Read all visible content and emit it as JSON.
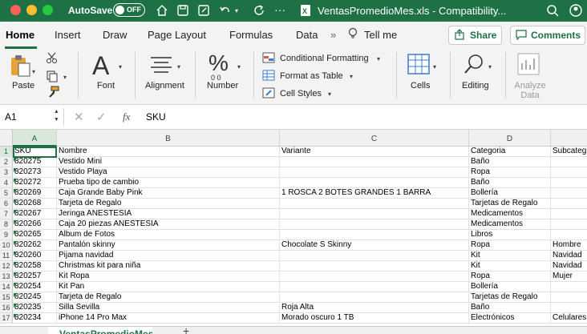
{
  "colors": {
    "brand": "#1e7145",
    "close": "#fe5f57",
    "minimize": "#febc2e",
    "maximize": "#28c840"
  },
  "titlebar": {
    "autosave_label": "AutoSave",
    "autosave_state": "OFF",
    "document_title": "VentasPromedioMes.xls - Compatibility...",
    "icons": [
      "home-icon",
      "save-icon",
      "edit-icon",
      "undo-icon",
      "redo-icon",
      "document-icon",
      "search-icon",
      "profile-icon"
    ]
  },
  "ribbon_tabs": {
    "items": [
      "Home",
      "Insert",
      "Draw",
      "Page Layout",
      "Formulas",
      "Data"
    ],
    "more": "»",
    "tell_me": "Tell me",
    "share": "Share",
    "comments": "Comments"
  },
  "ribbon": {
    "paste": "Paste",
    "font": "Font",
    "alignment": "Alignment",
    "number": "Number",
    "conditional_formatting": "Conditional Formatting",
    "format_as_table": "Format as Table",
    "cell_styles": "Cell Styles",
    "cells": "Cells",
    "editing": "Editing",
    "analyze_data": "Analyze Data"
  },
  "formula_bar": {
    "name_box": "A1",
    "fx": "fx",
    "content": "SKU"
  },
  "sheet": {
    "columns": [
      "A",
      "B",
      "C",
      "D",
      ""
    ],
    "rows": [
      [
        "SKU",
        "Nombre",
        "Variante",
        "Categoria",
        "Subcateg"
      ],
      [
        "820275",
        "Vestido Mini",
        "",
        "Baño",
        ""
      ],
      [
        "820273",
        "Vestido Playa",
        "",
        "Ropa",
        ""
      ],
      [
        "820272",
        "Prueba tipo de cambio",
        "",
        "Baño",
        ""
      ],
      [
        "820269",
        "Caja Grande Baby Pink",
        "1 ROSCA   2 BOTES GRANDES   1 BARRA",
        "Bollería",
        ""
      ],
      [
        "820268",
        "Tarjeta de Regalo",
        "",
        "Tarjetas de Regalo",
        ""
      ],
      [
        "820267",
        "Jeringa ANESTESIA",
        "",
        "Medicamentos",
        ""
      ],
      [
        "820266",
        "Caja 20 piezas ANESTESIA",
        "",
        "Medicamentos",
        ""
      ],
      [
        "820265",
        "Album de Fotos",
        "",
        "Libros",
        ""
      ],
      [
        "820262",
        "Pantalón skinny",
        "Chocolate S Skinny",
        "Ropa",
        "Hombre"
      ],
      [
        "820260",
        "Pijama navidad",
        "",
        "Kit",
        "Navidad"
      ],
      [
        "820258",
        "Christmas kit para niña",
        "",
        "Kit",
        "Navidad"
      ],
      [
        "820257",
        "Kit Ropa",
        "",
        "Ropa",
        "Mujer"
      ],
      [
        "820254",
        "Kit Pan",
        "",
        "Bollería",
        ""
      ],
      [
        "820245",
        "Tarjeta de Regalo",
        "",
        "Tarjetas de Regalo",
        ""
      ],
      [
        "820235",
        "Silla Sevilla",
        "Roja Alta",
        "Baño",
        ""
      ],
      [
        "820234",
        "iPhone 14 Pro Max",
        "Morado oscuro 1 TB",
        "Electrónicos",
        "Celulares"
      ]
    ],
    "row_numbers": [
      "1",
      "2",
      "3",
      "4",
      "5",
      "6",
      "7",
      "8",
      "9",
      "10",
      "11",
      "12",
      "13",
      "14",
      "15",
      "16",
      "17"
    ],
    "sheet_tab": "VentasPromedioMes",
    "add_sheet": "+"
  }
}
